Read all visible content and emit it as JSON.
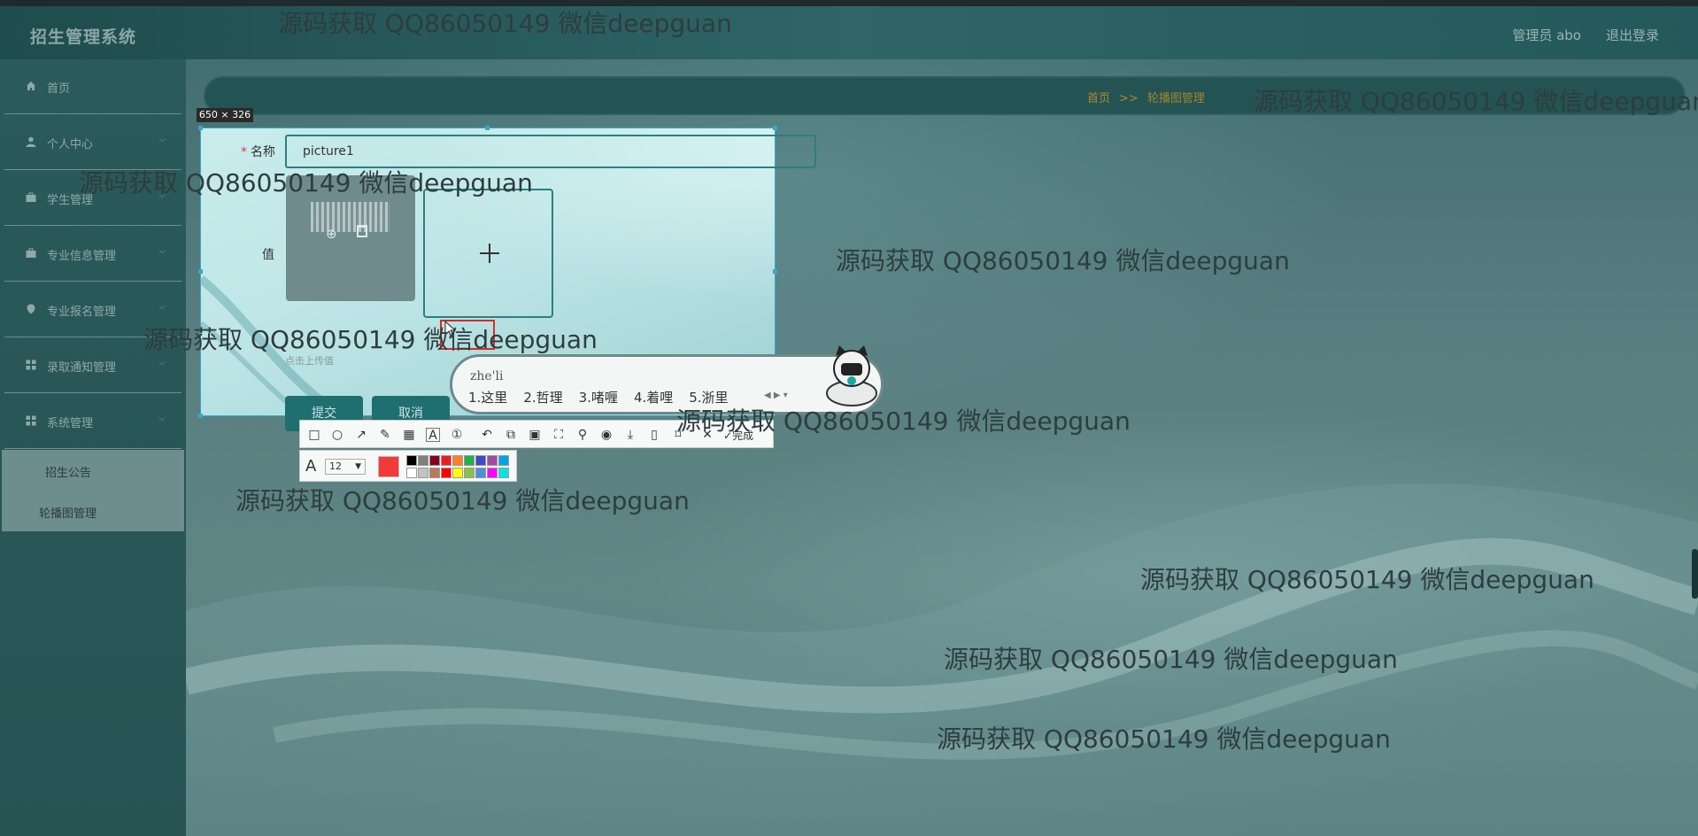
{
  "header": {
    "brand": "招生管理系统",
    "user": "管理员 abo",
    "logout": "退出登录"
  },
  "sidebar": {
    "items": [
      {
        "label": "首页",
        "icon": "home-icon"
      },
      {
        "label": "个人中心",
        "icon": "user-icon"
      },
      {
        "label": "学生管理",
        "icon": "briefcase-icon"
      },
      {
        "label": "专业信息管理",
        "icon": "briefcase-icon"
      },
      {
        "label": "专业报名管理",
        "icon": "pin-icon"
      },
      {
        "label": "录取通知管理",
        "icon": "grid-icon"
      },
      {
        "label": "系统管理",
        "icon": "grid-icon"
      }
    ],
    "submenu": [
      "招生公告",
      "轮播图管理"
    ]
  },
  "breadcrumb": {
    "home": "首页",
    "sep": ">>",
    "current": "轮播图管理"
  },
  "selection": {
    "size": "650 × 326"
  },
  "form": {
    "name_label": "名称",
    "name_value": "picture1",
    "value_label": "值",
    "upload_hint": "点击上传值",
    "submit": "提交",
    "cancel": "取消"
  },
  "ime": {
    "pinyin": "zhe'li",
    "candidates": [
      "1.这里",
      "2.哲理",
      "3.啫喱",
      "4.着哩",
      "5.浙里"
    ]
  },
  "toolbar": {
    "done": "完成",
    "font_size": "12",
    "current_color": "#f23a3a",
    "swatches_top": [
      "#000000",
      "#7f7f7f",
      "#880015",
      "#ed1c24",
      "#ff7f27",
      "#22b14c",
      "#3f48cc",
      "#a349a4",
      "#00a2e8"
    ],
    "swatches_bottom": [
      "#ffffff",
      "#c3c3c3",
      "#b97a57",
      "#ff0000",
      "#ffff00",
      "#8bc34a",
      "#4a90e2",
      "#ff00ff",
      "#00e5e5"
    ]
  },
  "watermark": "源码获取 QQ86050149 微信deepguan"
}
